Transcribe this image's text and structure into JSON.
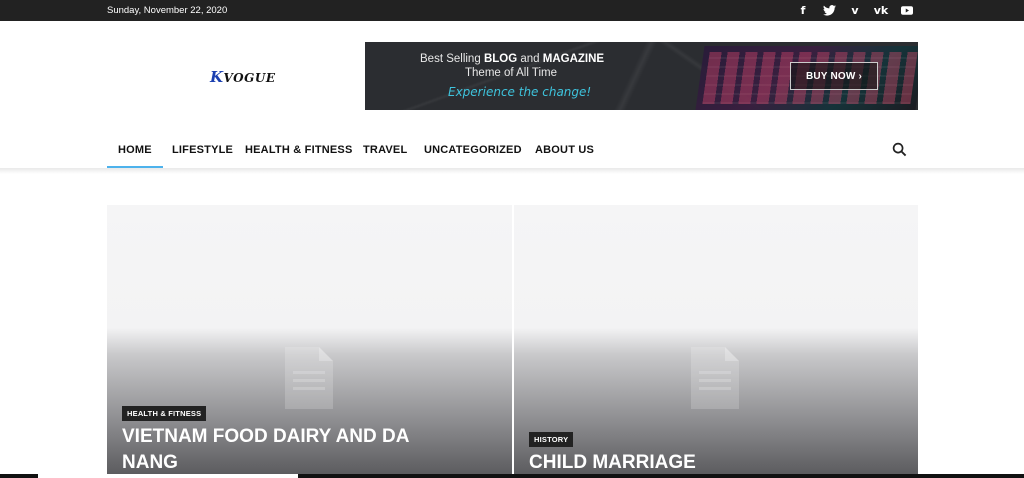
{
  "topbar": {
    "date": "Sunday, November 22, 2020",
    "socials": [
      "facebook-icon",
      "twitter-icon",
      "vimeo-icon",
      "vk-icon",
      "youtube-icon"
    ]
  },
  "logo": {
    "letter": "K",
    "text": "VOGUE"
  },
  "banner": {
    "line1_prefix": "Best Selling ",
    "line1_blog": "BLOG",
    "line1_mid": " and ",
    "line1_magazine": "MAGAZINE",
    "line2": "Theme of All Time",
    "line3": "Experience the change!",
    "button": "BUY NOW"
  },
  "nav": {
    "items": [
      "HOME",
      "LIFESTYLE",
      "HEALTH & FITNESS",
      "TRAVEL",
      "UNCATEGORIZED",
      "ABOUT US"
    ],
    "active": "HOME"
  },
  "posts": [
    {
      "category": "HEALTH & FITNESS",
      "title_line1": "VIETNAM FOOD DAIRY AND DA",
      "title_line2": "NANG"
    },
    {
      "category": "HISTORY",
      "title_line1": "CHILD MARRIAGE"
    }
  ],
  "colors": {
    "accent": "#4db2ec",
    "topbar": "#222222",
    "banner_highlight": "#3ec3dc"
  }
}
